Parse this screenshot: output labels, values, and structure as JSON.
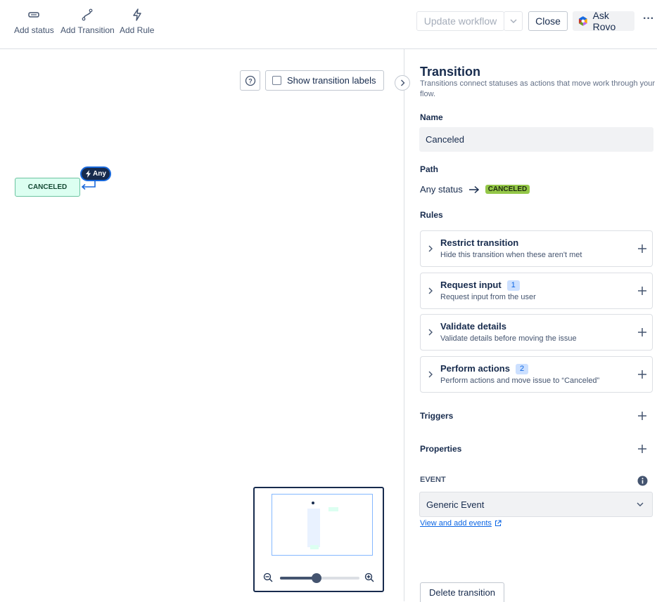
{
  "toolbar": {
    "add_status": "Add status",
    "add_transition": "Add Transition",
    "add_rule": "Add Rule",
    "update_workflow": "Update workflow",
    "close": "Close",
    "ask_rovo": "Ask Rovo",
    "more": "···"
  },
  "canvas": {
    "show_labels": "Show transition labels",
    "status_node": "CANCELED",
    "any_badge": "Any",
    "help": "?"
  },
  "panel": {
    "title": "Transition",
    "subtitle": "Transitions connect statuses as actions that move work through your flow.",
    "name_label": "Name",
    "name_value": "Canceled",
    "path_label": "Path",
    "path_from": "Any status",
    "path_to": "CANCELED",
    "rules_label": "Rules",
    "rules": [
      {
        "title": "Restrict transition",
        "sub": "Hide this transition when these aren't met",
        "count": ""
      },
      {
        "title": "Request input",
        "sub": "Request input from the user",
        "count": "1"
      },
      {
        "title": "Validate details",
        "sub": "Validate details before moving the issue",
        "count": ""
      },
      {
        "title": "Perform actions",
        "sub": "Perform actions and move issue to “Canceled”",
        "count": "2"
      }
    ],
    "triggers": "Triggers",
    "properties": "Properties",
    "event_label": "EVENT",
    "event_value": "Generic Event",
    "view_events": "View and add events",
    "delete": "Delete transition"
  },
  "colors": {
    "status_green_bg": "#dcfff1",
    "lozenge_green": "#94c748",
    "link_blue": "#0c66e4",
    "any_badge": "#172b4d"
  }
}
